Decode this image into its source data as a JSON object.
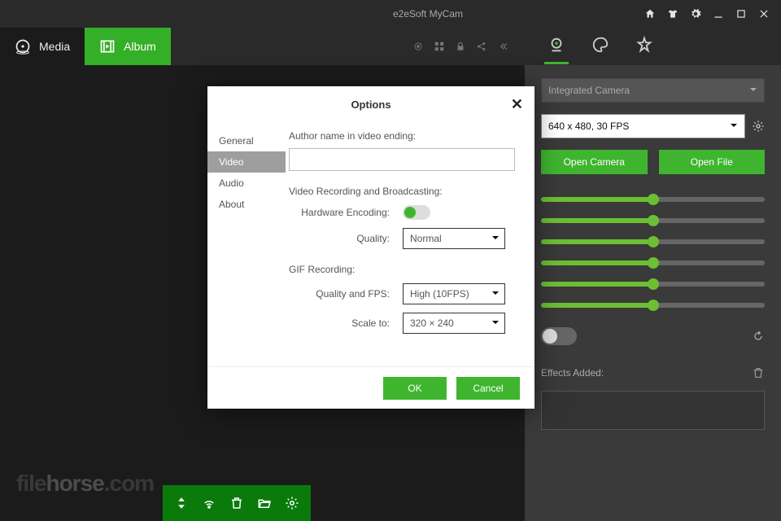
{
  "titlebar": {
    "title": "e2eSoft MyCam"
  },
  "tabs": {
    "media": "Media",
    "album": "Album"
  },
  "right": {
    "camera_select": "Integrated Camera",
    "resolution_select": "640 x 480, 30 FPS",
    "open_camera": "Open Camera",
    "open_file": "Open File",
    "sliders": [
      50,
      50,
      50,
      50,
      50,
      50
    ],
    "effects_label": "Effects Added:"
  },
  "modal": {
    "title": "Options",
    "nav": {
      "general": "General",
      "video": "Video",
      "audio": "Audio",
      "about": "About"
    },
    "author_label": "Author name in video ending:",
    "author_value": "",
    "section_rec": "Video Recording and Broadcasting:",
    "hw_enc_label": "Hardware Encoding:",
    "quality_label": "Quality:",
    "quality_value": "Normal",
    "section_gif": "GIF Recording:",
    "gif_quality_label": "Quality and FPS:",
    "gif_quality_value": "High (10FPS)",
    "scale_label": "Scale to:",
    "scale_value": "320 × 240",
    "ok": "OK",
    "cancel": "Cancel"
  },
  "watermark": {
    "a": "file",
    "b": "horse",
    "c": ".com"
  }
}
